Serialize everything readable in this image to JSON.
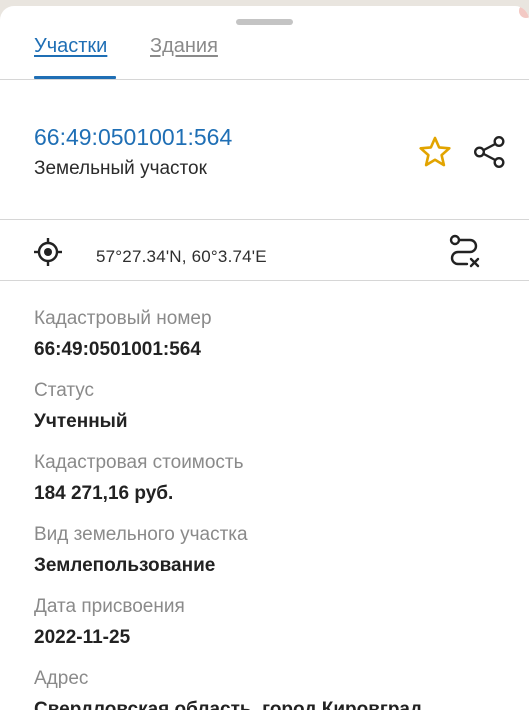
{
  "tabs": [
    {
      "label": "Участки",
      "active": true
    },
    {
      "label": "Здания",
      "active": false
    }
  ],
  "parcel": {
    "title": "66:49:0501001:564",
    "subtitle": "Земельный участок"
  },
  "location": {
    "coordinates": "57°27.34'N, 60°3.74'E"
  },
  "details": [
    {
      "label": "Кадастровый номер",
      "value": "66:49:0501001:564"
    },
    {
      "label": "Статус",
      "value": "Учтенный"
    },
    {
      "label": "Кадастровая стоимость",
      "value": "184 271,16 руб."
    },
    {
      "label": "Вид земельного участка",
      "value": "Землепользование"
    },
    {
      "label": "Дата присвоения",
      "value": "2022-11-25"
    },
    {
      "label": "Адрес",
      "value": "Свердловская область, город Кировград,"
    }
  ],
  "colors": {
    "accent": "#1f6fb5",
    "star": "#e2a400",
    "label": "#8a8a8a"
  },
  "icons": {
    "favorite": "star-icon",
    "share": "share-icon",
    "locate": "crosshair-icon",
    "route": "route-icon"
  }
}
